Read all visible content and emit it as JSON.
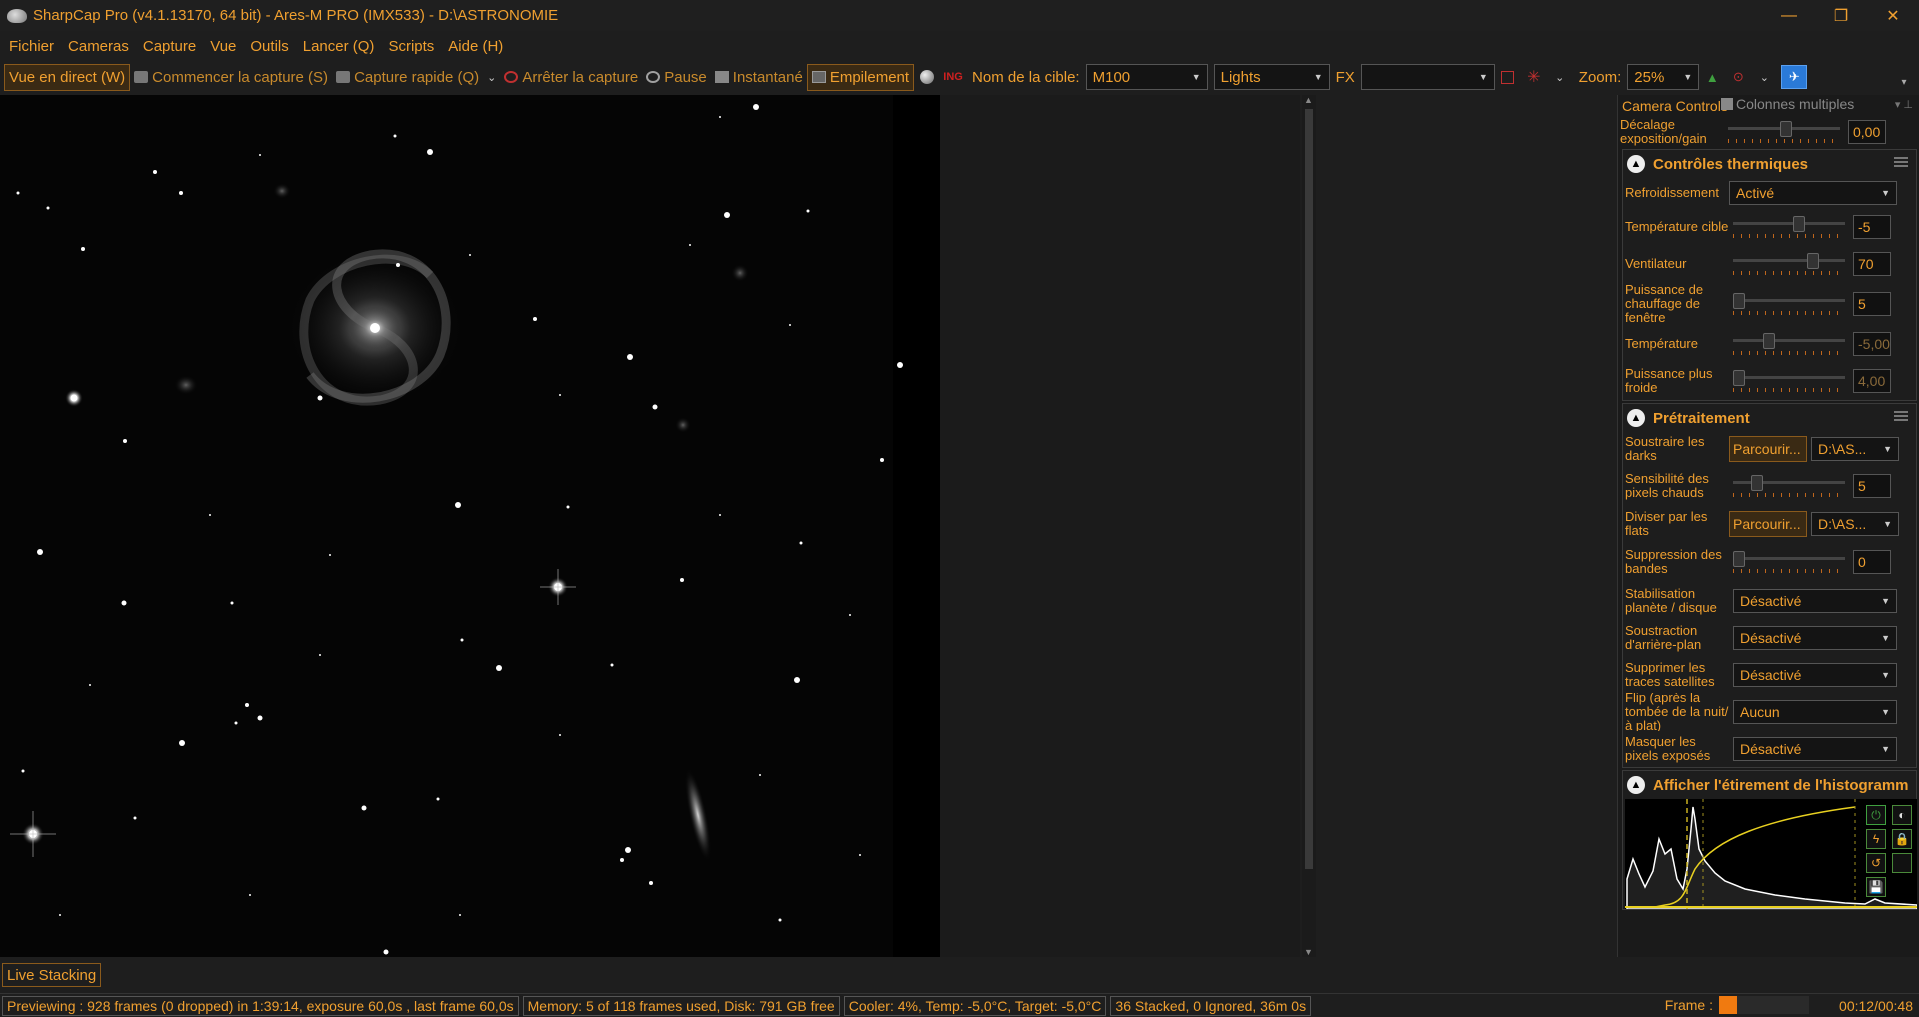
{
  "window": {
    "title": "SharpCap Pro (v4.1.13170, 64 bit) - Ares-M PRO (IMX533) - D:\\ASTRONOMIE",
    "minimize": "—",
    "restore": "❐",
    "close": "✕"
  },
  "menu": [
    "Fichier",
    "Cameras",
    "Capture",
    "Vue",
    "Outils",
    "Lancer (Q)",
    "Scripts",
    "Aide (H)"
  ],
  "toolbar": {
    "live_view": "Vue en direct (W)",
    "start_capture": "Commencer la capture (S)",
    "quick_capture": "Capture rapide (Q)",
    "stop_capture": "Arrêter la capture",
    "pause": "Pause",
    "snapshot": "Instantané",
    "stacking": "Empilement",
    "target_label": "Nom de la cible:",
    "target_value": "M100",
    "frame_type": "Lights",
    "fx_label": "FX",
    "fx_value": "",
    "zoom_label": "Zoom:",
    "zoom_value": "25%"
  },
  "panel": {
    "header": "Camera Controls",
    "multi_columns": "Colonnes multiples",
    "exposure_offset": {
      "label": "Décalage exposition/gain",
      "value": "0,00"
    },
    "thermal": {
      "title": "Contrôles thermiques",
      "cooling_label": "Refroidissement",
      "cooling_value": "Activé",
      "target_temp_label": "Température cible",
      "target_temp_value": "-5",
      "fan_label": "Ventilateur",
      "fan_value": "70",
      "heater_label": "Puissance de chauffage de fenêtre",
      "heater_value": "5",
      "temp_label": "Température",
      "temp_value": "-5,00",
      "cooler_power_label": "Puissance plus froide",
      "cooler_power_value": "4,00"
    },
    "preprocessing": {
      "title": "Prétraitement",
      "darks_label": "Soustraire les darks",
      "browse": "Parcourir...",
      "darks_path": "D:\\AS...",
      "hot_pixels_label": "Sensibilité des pixels chauds",
      "hot_pixels_value": "5",
      "flats_label": "Diviser par les flats",
      "flats_path": "D:\\AS...",
      "banding_label": "Suppression des bandes",
      "banding_value": "0",
      "stabilization_label": "Stabilisation planète / disque",
      "stabilization_value": "Désactivé",
      "background_label": "Soustraction d'arrière-plan",
      "background_value": "Désactivé",
      "satellite_label": "Supprimer les traces satellites",
      "satellite_value": "Désactivé",
      "flip_label": "Flip (après la tombée de la nuit/à plat)",
      "flip_value": "Aucun",
      "mask_label": "Masquer les pixels exposés",
      "mask_value": "Désactivé"
    },
    "histogram": {
      "title": "Afficher l'étirement de l'histogramm"
    }
  },
  "bottom_tab": "Live Stacking",
  "status": {
    "preview": "Previewing : 928 frames (0 dropped) in 1:39:14, exposure 60,0s , last frame 60,0s",
    "memory": "Memory: 5 of 118 frames used, Disk: 791 GB free",
    "cooler": "Cooler: 4%, Temp: -5,0°C, Target: -5,0°C",
    "stack": "36 Stacked, 0 Ignored, 36m 0s",
    "frame_label": "Frame :",
    "frame_progress": 0.2,
    "time": "00:12/00:48"
  },
  "colors": {
    "accent": "#f0a030",
    "background": "#1e1e1e",
    "progress": "#f07a10"
  }
}
